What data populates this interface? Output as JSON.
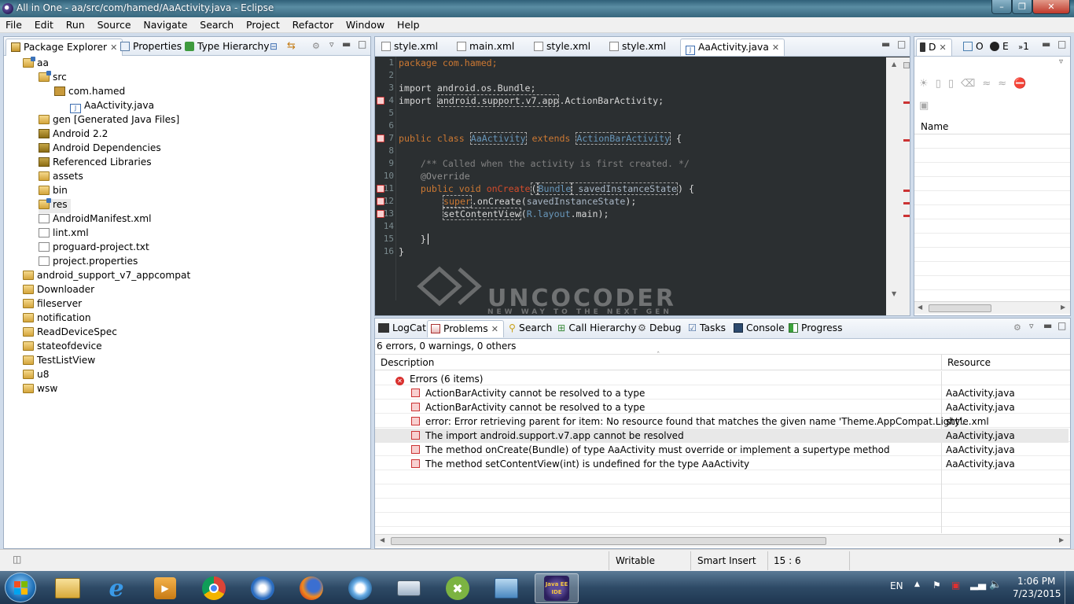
{
  "window": {
    "title": "All in One - aa/src/com/hamed/AaActivity.java - Eclipse"
  },
  "menu": [
    "File",
    "Edit",
    "Run",
    "Source",
    "Navigate",
    "Search",
    "Project",
    "Refactor",
    "Window",
    "Help"
  ],
  "left_tabs": {
    "package_explorer": "Package Explorer",
    "properties": "Properties",
    "type_hierarchy": "Type Hierarchy"
  },
  "tree": [
    {
      "label": "aa",
      "icon": "project-icon"
    },
    {
      "label": "src",
      "icon": "source-folder-icon"
    },
    {
      "label": "com.hamed",
      "icon": "package-icon"
    },
    {
      "label": "AaActivity.java",
      "icon": "java-file-icon"
    },
    {
      "label": "gen [Generated Java Files]",
      "icon": "source-folder-icon"
    },
    {
      "label": "Android 2.2",
      "icon": "library-icon"
    },
    {
      "label": "Android Dependencies",
      "icon": "library-icon"
    },
    {
      "label": "Referenced Libraries",
      "icon": "library-icon"
    },
    {
      "label": "assets",
      "icon": "folder-icon"
    },
    {
      "label": "bin",
      "icon": "folder-icon"
    },
    {
      "label": "res",
      "icon": "folder-icon"
    },
    {
      "label": "AndroidManifest.xml",
      "icon": "xml-file-icon"
    },
    {
      "label": "lint.xml",
      "icon": "xml-file-icon"
    },
    {
      "label": "proguard-project.txt",
      "icon": "text-file-icon"
    },
    {
      "label": "project.properties",
      "icon": "text-file-icon"
    },
    {
      "label": "android_support_v7_appcompat",
      "icon": "project-icon"
    },
    {
      "label": "Downloader",
      "icon": "project-icon"
    },
    {
      "label": "fileserver",
      "icon": "project-icon"
    },
    {
      "label": "notification",
      "icon": "project-icon"
    },
    {
      "label": "ReadDeviceSpec",
      "icon": "project-icon"
    },
    {
      "label": "stateofdevice",
      "icon": "project-icon"
    },
    {
      "label": "TestListView",
      "icon": "project-icon"
    },
    {
      "label": "u8",
      "icon": "project-icon"
    },
    {
      "label": "wsw",
      "icon": "project-icon"
    }
  ],
  "editor_tabs": [
    "style.xml",
    "main.xml",
    "style.xml",
    "style.xml",
    "AaActivity.java"
  ],
  "code_lines": {
    "l1": "package com.hamed;",
    "l3": "import android.os.Bundle;",
    "l4a": "import ",
    "l4b": "android.support.v7.app",
    "l4c": ".ActionBarActivity;",
    "l7a": "public class ",
    "l7b": "AaActivity",
    "l7c": " extends ",
    "l7d": "ActionBarActivity",
    "l7e": " {",
    "l9": "    /** Called when the activity is first created. */",
    "l10": "    @Override",
    "l11a": "    public void ",
    "l11b": "onCreate",
    "l11c": "(",
    "l11d": "Bundle",
    "l11e": " savedInstanceState",
    "l11f": ") {",
    "l12a": "super",
    "l12b": ".onCreate(",
    "l12c": "savedInstanceState",
    "l12d": ");",
    "l13a": "setContentView",
    "l13b": "(",
    "l13c": "R",
    "l13d": ".layout",
    "l13e": ".main);",
    "l15": "    }",
    "l16": "}"
  },
  "line_numbers": [
    "1",
    "2",
    "3",
    "4",
    "5",
    "6",
    "7",
    "8",
    "9",
    "10",
    "11",
    "12",
    "13",
    "14",
    "15",
    "16"
  ],
  "right_panel": {
    "tab_d": "D",
    "tab_o": "O",
    "tab_e": "E",
    "tab_more": "1",
    "column_name": "Name"
  },
  "bottom_tabs": [
    "LogCat",
    "Problems",
    "Search",
    "Call Hierarchy",
    "Debug",
    "Tasks",
    "Console",
    "Progress"
  ],
  "problems": {
    "summary": "6 errors, 0 warnings, 0 others",
    "col_description": "Description",
    "col_resource": "Resource",
    "group": "Errors (6 items)",
    "items": [
      {
        "desc": "ActionBarActivity cannot be resolved to a type",
        "res": "AaActivity.java"
      },
      {
        "desc": "ActionBarActivity cannot be resolved to a type",
        "res": "AaActivity.java"
      },
      {
        "desc": "error: Error retrieving parent for item: No resource found that matches the given name 'Theme.AppCompat.Light'.",
        "res": "style.xml"
      },
      {
        "desc": "The import android.support.v7.app cannot be resolved",
        "res": "AaActivity.java"
      },
      {
        "desc": "The method onCreate(Bundle) of type AaActivity must override or implement a supertype method",
        "res": "AaActivity.java"
      },
      {
        "desc": "The method setContentView(int) is undefined for the type AaActivity",
        "res": "AaActivity.java"
      }
    ]
  },
  "status": {
    "writable": "Writable",
    "insert": "Smart Insert",
    "position": "15 : 6"
  },
  "taskbar": {
    "lang": "EN",
    "time": "1:06 PM",
    "date": "7/23/2015",
    "eclipse_label": "Java EE IDE"
  },
  "watermark": {
    "brand": "UNCOCODER",
    "tagline": "NEW WAY TO THE NEXT GEN"
  }
}
